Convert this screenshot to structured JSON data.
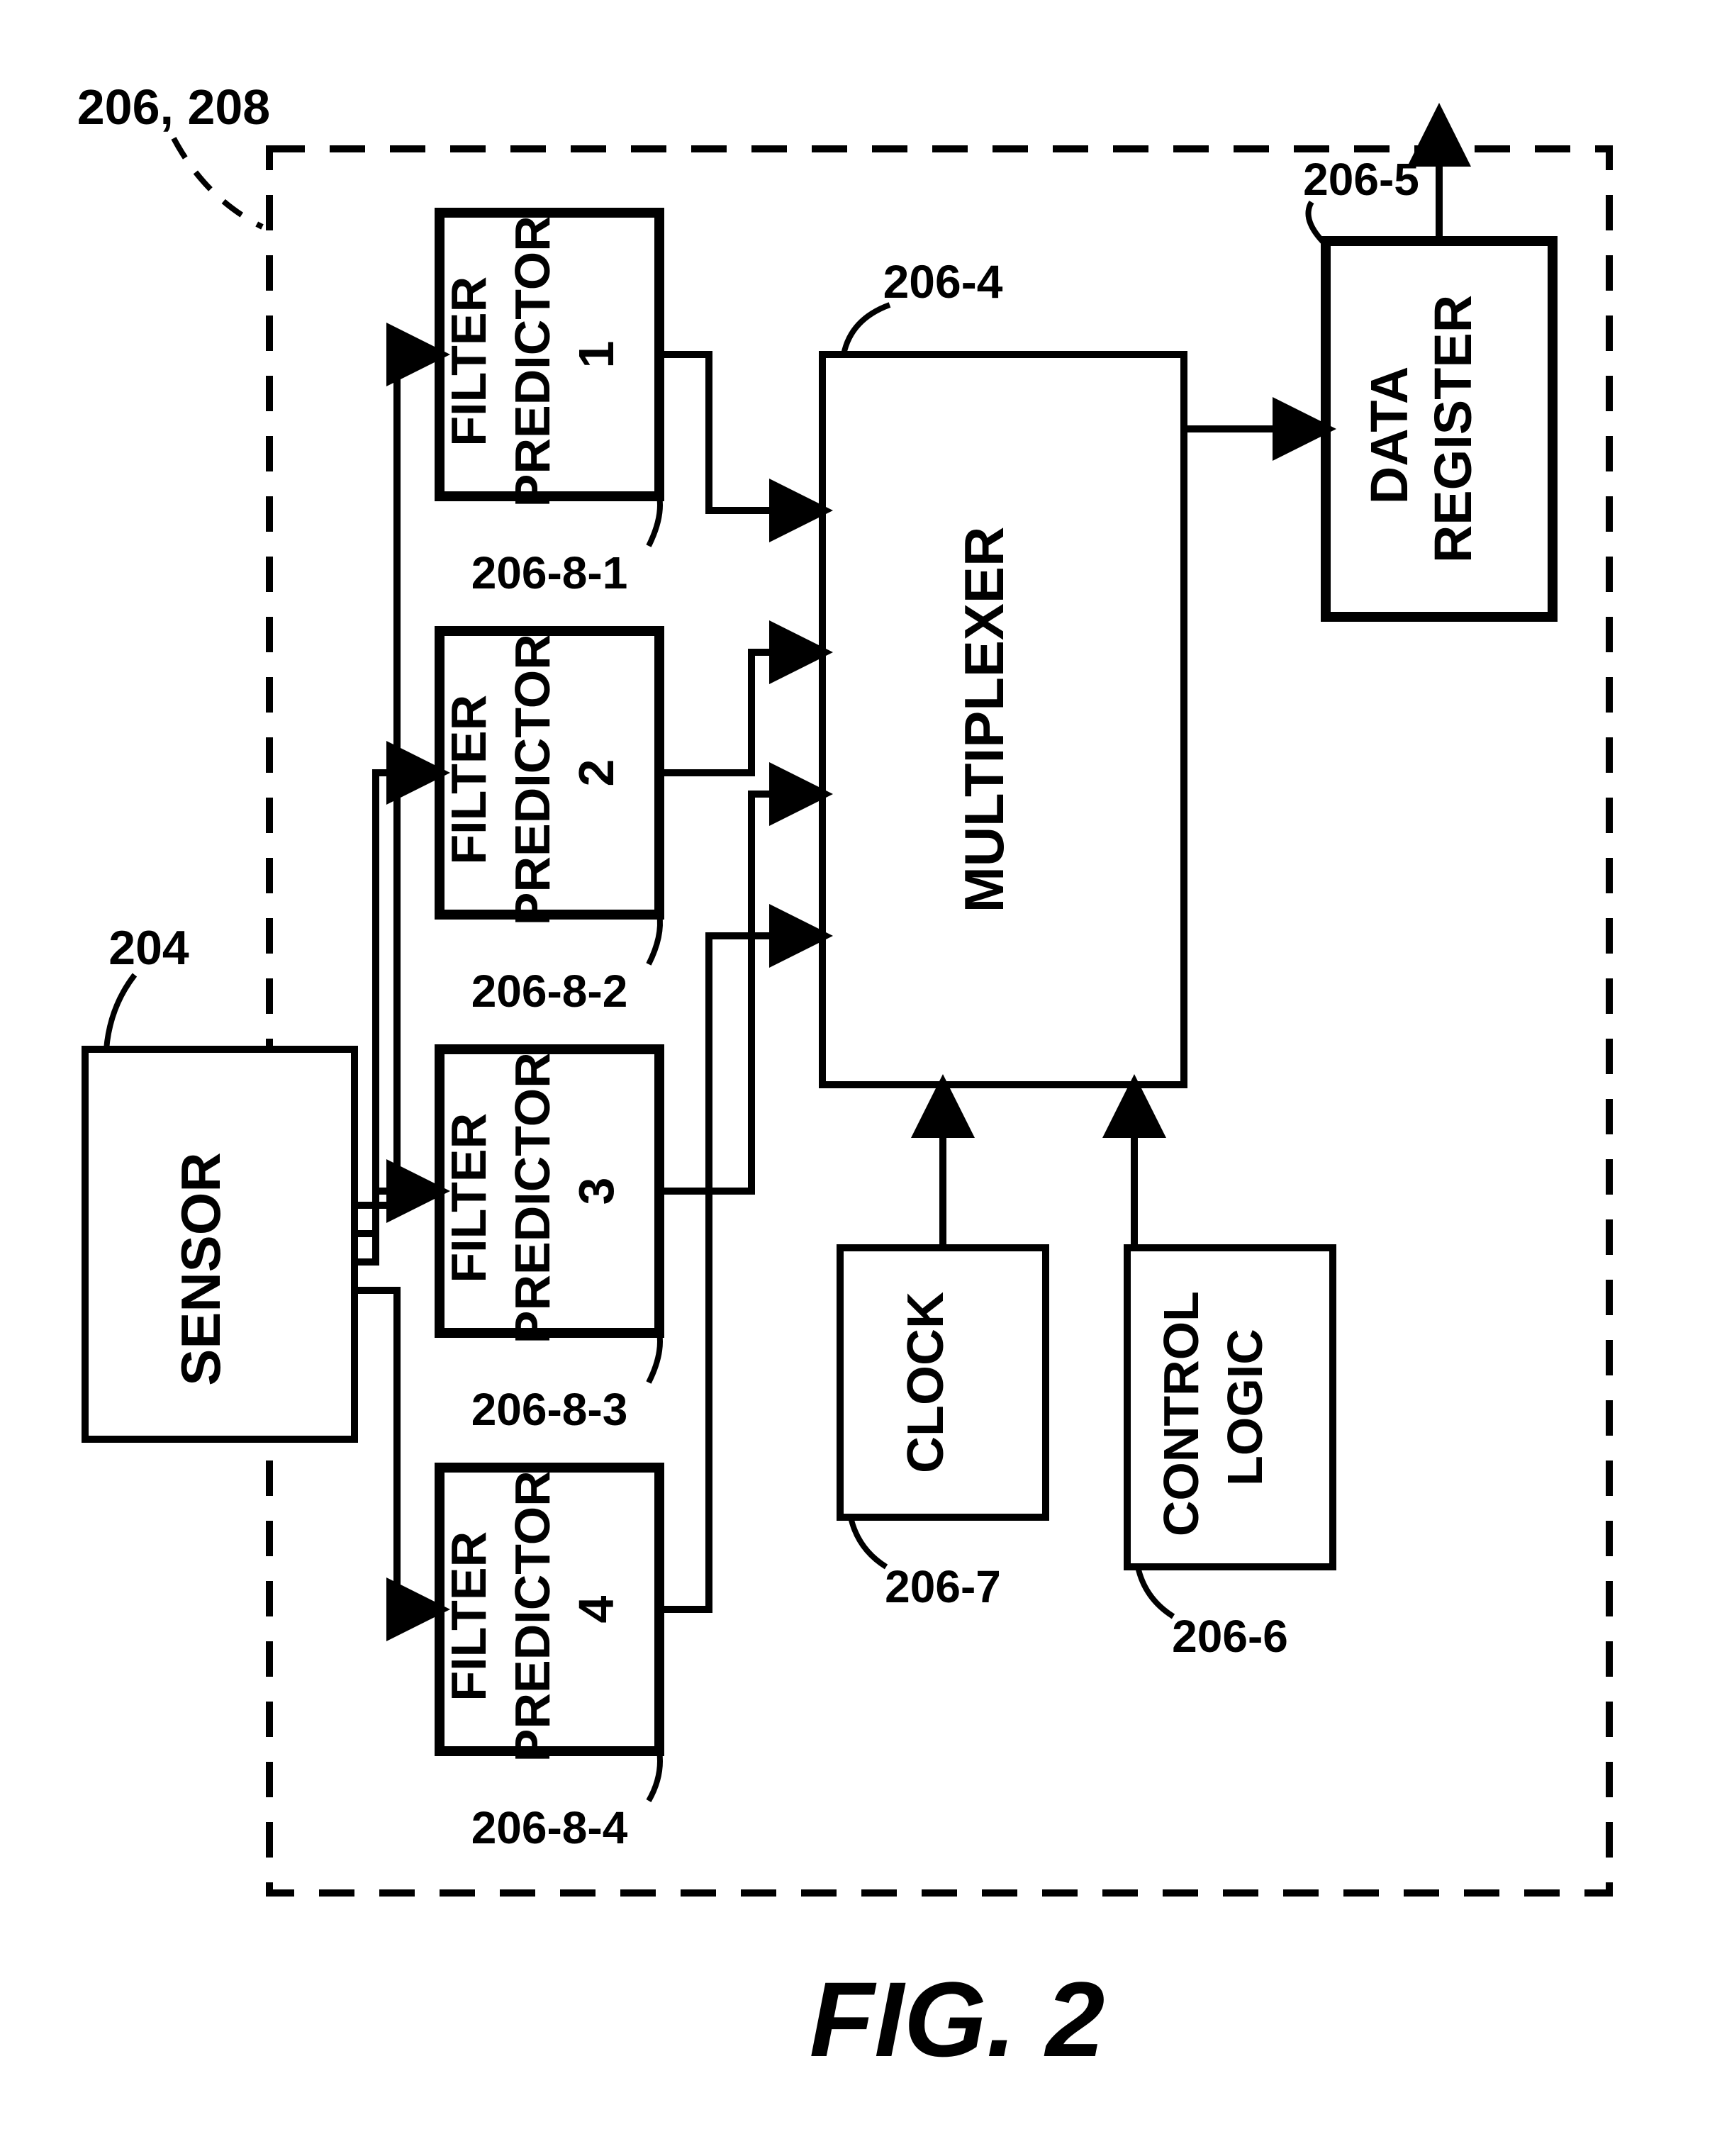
{
  "figure_label": "FIG. 2",
  "container_ref": "206, 208",
  "sensor": {
    "label": "SENSOR",
    "ref": "204"
  },
  "filters": [
    {
      "label_top": "FILTER",
      "label_mid": "PREDICTOR",
      "num": "1",
      "ref": "206-8-1"
    },
    {
      "label_top": "FILTER",
      "label_mid": "PREDICTOR",
      "num": "2",
      "ref": "206-8-2"
    },
    {
      "label_top": "FILTER",
      "label_mid": "PREDICTOR",
      "num": "3",
      "ref": "206-8-3"
    },
    {
      "label_top": "FILTER",
      "label_mid": "PREDICTOR",
      "num": "4",
      "ref": "206-8-4"
    }
  ],
  "mux": {
    "label": "MULTIPLEXER",
    "ref": "206-4"
  },
  "register": {
    "label_top": "DATA",
    "label_bot": "REGISTER",
    "ref": "206-5"
  },
  "control": {
    "label_top": "CONTROL",
    "label_bot": "LOGIC",
    "ref": "206-6"
  },
  "clock": {
    "label": "CLOCK",
    "ref": "206-7"
  }
}
